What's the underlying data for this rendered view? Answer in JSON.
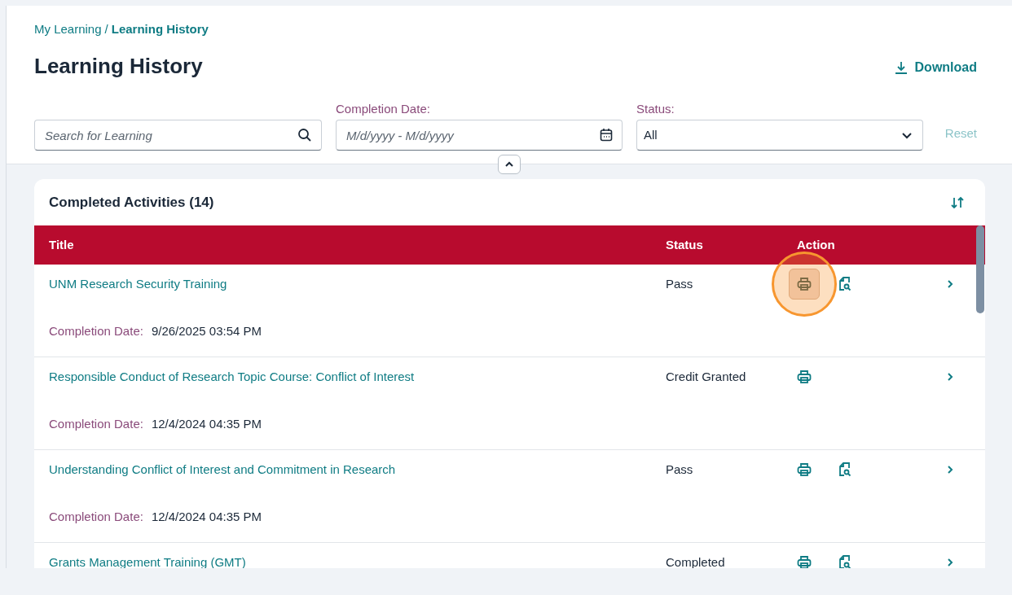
{
  "breadcrumb": [
    {
      "label": "My Learning",
      "current": false
    },
    {
      "label": "Learning History",
      "current": true
    }
  ],
  "breadcrumb_separator": "/",
  "page_title": "Learning History",
  "download_button": "Download",
  "filters": {
    "search": {
      "placeholder": "Search for Learning"
    },
    "completion_date": {
      "label": "Completion Date:",
      "placeholder": "M/d/yyyy - M/d/yyyy"
    },
    "status": {
      "label": "Status:",
      "value": "All"
    },
    "reset_button": "Reset"
  },
  "card": {
    "title": "Completed Activities (14)",
    "columns": [
      "Title",
      "Status",
      "Action"
    ],
    "rows": [
      {
        "title": "UNM Research Security Training",
        "status": "Pass",
        "date_label": "Completion Date:",
        "date": "9/26/2025 03:54 PM",
        "actions": [
          {
            "kind": "print",
            "highlighted": true
          },
          {
            "kind": "preview",
            "highlighted": false
          }
        ]
      },
      {
        "title": "Responsible Conduct of Research Topic Course: Conflict of Interest",
        "status": "Credit Granted",
        "date_label": "Completion Date:",
        "date": "12/4/2024 04:35 PM",
        "actions": [
          {
            "kind": "print",
            "highlighted": false
          }
        ]
      },
      {
        "title": "Understanding Conflict of Interest and Commitment in Research",
        "status": "Pass",
        "date_label": "Completion Date:",
        "date": "12/4/2024 04:35 PM",
        "actions": [
          {
            "kind": "print",
            "highlighted": false
          },
          {
            "kind": "preview",
            "highlighted": false
          }
        ]
      },
      {
        "title": "Grants Management Training (GMT)",
        "status": "Completed",
        "actions": [
          {
            "kind": "print",
            "highlighted": false
          },
          {
            "kind": "preview",
            "highlighted": false
          }
        ]
      }
    ]
  }
}
